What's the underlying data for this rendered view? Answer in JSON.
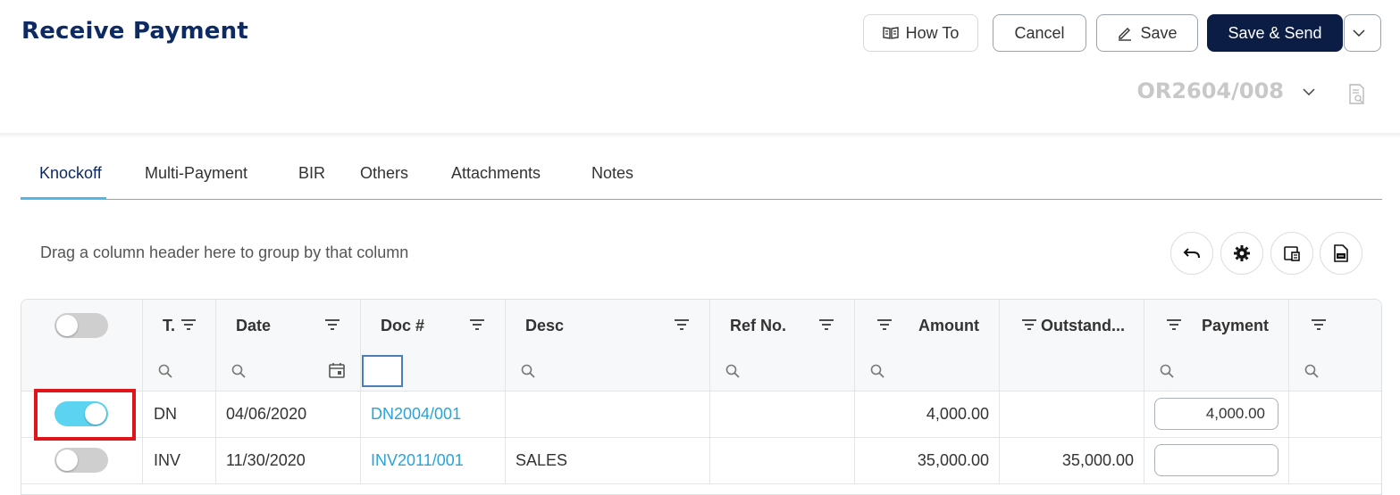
{
  "page": {
    "title": "Receive Payment"
  },
  "toolbar": {
    "how_to": "How To",
    "cancel": "Cancel",
    "save": "Save",
    "save_send": "Save & Send"
  },
  "document": {
    "number": "OR2604/008"
  },
  "tabs": [
    {
      "label": "Knockoff",
      "active": true
    },
    {
      "label": "Multi-Payment",
      "active": false
    },
    {
      "label": "BIR",
      "active": false
    },
    {
      "label": "Others",
      "active": false
    },
    {
      "label": "Attachments",
      "active": false
    },
    {
      "label": "Notes",
      "active": false
    }
  ],
  "grid": {
    "group_hint": "Drag a column header here to group by that column",
    "select_all_on": false,
    "columns": [
      "T.",
      "Date",
      "Doc #",
      "Desc",
      "Ref No.",
      "Amount",
      "Outstand...",
      "Payment",
      ""
    ],
    "rows": [
      {
        "selected": true,
        "type": "DN",
        "date": "04/06/2020",
        "doc": "DN2004/001",
        "desc": "",
        "ref": "",
        "amount": "4,000.00",
        "outstanding": "",
        "payment": "4,000.00"
      },
      {
        "selected": false,
        "type": "INV",
        "date": "11/30/2020",
        "doc": "INV2011/001",
        "desc": "SALES",
        "ref": "",
        "amount": "35,000.00",
        "outstanding": "35,000.00",
        "payment": ""
      }
    ]
  },
  "colors": {
    "brand": "#0d2a63",
    "primary_button": "#0b1c45",
    "link": "#2aa3d8",
    "toggle_on": "#5dd3f2",
    "annotation": "#e0141b"
  },
  "icons": [
    "book-icon",
    "pencil-icon",
    "chevron-down-icon",
    "document-search-icon",
    "undo-icon",
    "gear-icon",
    "column-chooser-icon",
    "export-icon",
    "filter-icon",
    "search-icon",
    "calendar-icon"
  ]
}
